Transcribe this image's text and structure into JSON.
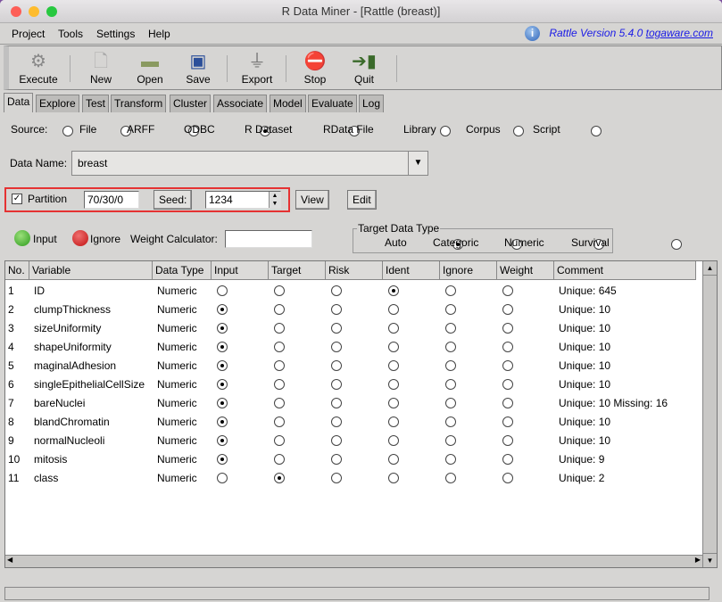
{
  "window": {
    "title": "R Data Miner - [Rattle (breast)]"
  },
  "menu": [
    "Project",
    "Tools",
    "Settings",
    "Help"
  ],
  "version": {
    "text": "Rattle Version 5.4.0",
    "link": "togaware.com",
    "icon": "info-icon"
  },
  "toolbar": [
    {
      "label": "Execute",
      "icon": "gears-icon"
    },
    {
      "label": "New",
      "icon": "new-file-icon"
    },
    {
      "label": "Open",
      "icon": "folder-icon"
    },
    {
      "label": "Save",
      "icon": "floppy-icon"
    },
    {
      "label": "Export",
      "icon": "export-icon"
    },
    {
      "label": "Stop",
      "icon": "stop-icon"
    },
    {
      "label": "Quit",
      "icon": "exit-icon"
    }
  ],
  "tabs": [
    "Data",
    "Explore",
    "Test",
    "Transform",
    "Cluster",
    "Associate",
    "Model",
    "Evaluate",
    "Log"
  ],
  "source": {
    "label": "Source:",
    "options": [
      "File",
      "ARFF",
      "ODBC",
      "R Dataset",
      "RData File",
      "Library",
      "Corpus",
      "Script"
    ],
    "selected": "R Dataset"
  },
  "data_name": {
    "label": "Data Name:",
    "value": "breast"
  },
  "partition": {
    "label": "Partition",
    "checked": true,
    "value": "70/30/0",
    "seed_label": "Seed:",
    "seed": "1234",
    "view": "View",
    "edit": "Edit",
    "highlight_color": "#e53232"
  },
  "roles": {
    "input": "Input",
    "ignore": "Ignore",
    "weight_label": "Weight Calculator:",
    "weight_value": ""
  },
  "target_type": {
    "legend": "Target Data Type",
    "options": [
      "Auto",
      "Categoric",
      "Numeric",
      "Survival"
    ],
    "selected": "Auto"
  },
  "table": {
    "columns": [
      "No.",
      "Variable",
      "Data Type",
      "Input",
      "Target",
      "Risk",
      "Ident",
      "Ignore",
      "Weight",
      "Comment"
    ],
    "rows": [
      {
        "no": "1",
        "var": "ID",
        "type": "Numeric",
        "role": "Ident",
        "comment": "Unique: 645"
      },
      {
        "no": "2",
        "var": "clumpThickness",
        "type": "Numeric",
        "role": "Input",
        "comment": "Unique: 10"
      },
      {
        "no": "3",
        "var": "sizeUniformity",
        "type": "Numeric",
        "role": "Input",
        "comment": "Unique: 10"
      },
      {
        "no": "4",
        "var": "shapeUniformity",
        "type": "Numeric",
        "role": "Input",
        "comment": "Unique: 10"
      },
      {
        "no": "5",
        "var": "maginalAdhesion",
        "type": "Numeric",
        "role": "Input",
        "comment": "Unique: 10"
      },
      {
        "no": "6",
        "var": "singleEpithelialCellSize",
        "type": "Numeric",
        "role": "Input",
        "comment": "Unique: 10"
      },
      {
        "no": "7",
        "var": "bareNuclei",
        "type": "Numeric",
        "role": "Input",
        "comment": "Unique: 10 Missing: 16"
      },
      {
        "no": "8",
        "var": "blandChromatin",
        "type": "Numeric",
        "role": "Input",
        "comment": "Unique: 10"
      },
      {
        "no": "9",
        "var": "normalNucleoli",
        "type": "Numeric",
        "role": "Input",
        "comment": "Unique: 10"
      },
      {
        "no": "10",
        "var": "mitosis",
        "type": "Numeric",
        "role": "Input",
        "comment": "Unique: 9"
      },
      {
        "no": "11",
        "var": "class",
        "type": "Numeric",
        "role": "Target",
        "comment": "Unique: 2"
      }
    ]
  }
}
